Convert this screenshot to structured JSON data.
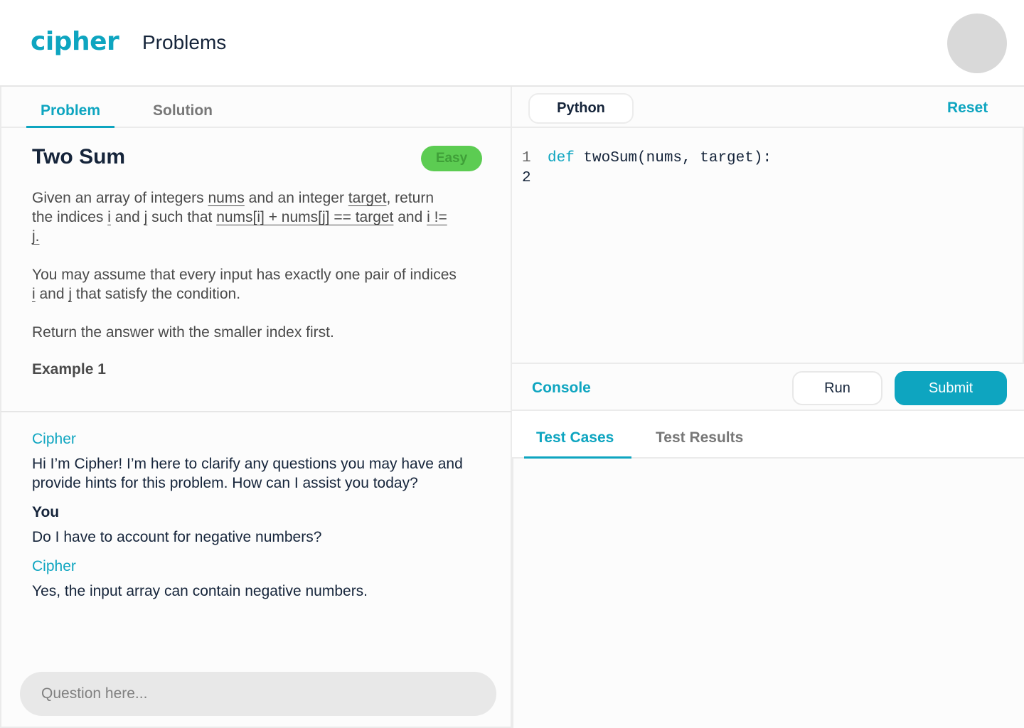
{
  "header": {
    "logo": "cipher",
    "nav_title": "Problems",
    "avatar_color": "#d9d9d9"
  },
  "colors": {
    "accent": "#0ea5c0",
    "badge_bg": "#5ccc52",
    "badge_text": "#3f9f38",
    "dark_text": "#15243a"
  },
  "problem_panel": {
    "tabs": [
      {
        "label": "Problem",
        "active": true
      },
      {
        "label": "Solution",
        "active": false
      }
    ],
    "title": "Two Sum",
    "difficulty": "Easy",
    "description": {
      "p1": {
        "t1": "Given an array of integers ",
        "u1": "nums",
        "t2": " and an integer ",
        "u2": "target",
        "t3": ", return the indices ",
        "u3": "i",
        "t4": " and ",
        "u4": "j",
        "t5": " such that ",
        "u5": "nums[i] + nums[j] == target",
        "t6": " and ",
        "u6": "i != j."
      },
      "p2": {
        "t1": "You may assume that every input has exactly one pair of indices ",
        "u1": "i",
        "t2": " and ",
        "u2": "j",
        "t3": " that satisfy the condition."
      },
      "p3": "Return the answer with the smaller index first."
    },
    "example_label": "Example 1"
  },
  "chat": {
    "messages": [
      {
        "author": "Cipher",
        "text": "Hi I’m Cipher! I’m here to clarify any questions you may have and provide hints for this problem. How can I assist you today?"
      },
      {
        "author": "You",
        "text": "Do I have to account for negative numbers?"
      },
      {
        "author": "Cipher",
        "text": "Yes, the input array can contain negative numbers."
      }
    ],
    "input_placeholder": "Question here...",
    "input_value": ""
  },
  "editor": {
    "language": "Python",
    "reset_label": "Reset",
    "lines": [
      {
        "number": "1",
        "keyword": "def",
        "rest": " twoSum(nums, target):"
      },
      {
        "number": "2",
        "keyword": "",
        "rest": ""
      }
    ]
  },
  "console": {
    "label": "Console",
    "run_label": "Run",
    "submit_label": "Submit",
    "tabs": [
      {
        "label": "Test Cases",
        "active": true
      },
      {
        "label": "Test Results",
        "active": false
      }
    ]
  }
}
